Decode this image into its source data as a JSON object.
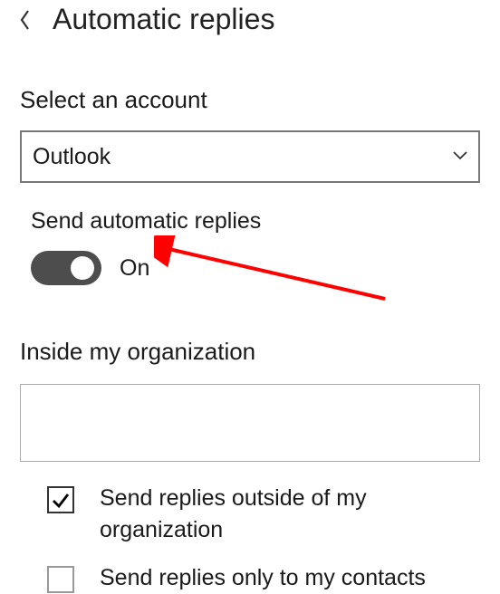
{
  "header": {
    "title": "Automatic replies"
  },
  "account": {
    "label": "Select an account",
    "selected": "Outlook"
  },
  "toggle": {
    "label": "Send automatic replies",
    "state": "On"
  },
  "inside_org": {
    "label": "Inside my organization",
    "value": ""
  },
  "checkboxes": {
    "outside": "Send replies outside of my organization",
    "contacts": "Send replies only to my contacts"
  },
  "annotation": {
    "color": "#ff0000"
  }
}
